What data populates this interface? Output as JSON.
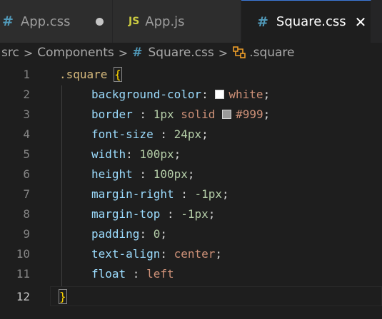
{
  "tabs": [
    {
      "icon": "#",
      "label": "App.css",
      "dirty": true
    },
    {
      "icon": "JS",
      "label": "App.js"
    },
    {
      "icon": "#",
      "label": "Square.css",
      "close": "✕"
    }
  ],
  "breadcrumb": {
    "parts": [
      "src",
      "Components",
      "Square.css",
      ".square"
    ],
    "separator": ">"
  },
  "colors": {
    "swatch_white": "#ffffff",
    "swatch_999": "#999999"
  },
  "editor": {
    "line_numbers": [
      "1",
      "2",
      "3",
      "4",
      "5",
      "6",
      "7",
      "8",
      "9",
      "10",
      "11",
      "12"
    ],
    "lines": [
      {
        "selector": ".square",
        "brace": "{"
      },
      {
        "prop": "background-color",
        "sep": ": ",
        "value": "white",
        "end": ";"
      },
      {
        "prop": "border",
        "sep": " : ",
        "num": "1px",
        "value": "solid",
        "value2": "#999",
        "end": ";"
      },
      {
        "prop": "font-size",
        "sep": " : ",
        "num": "24px",
        "end": ";"
      },
      {
        "prop": "width",
        "sep": ": ",
        "num": "100px",
        "end": ";"
      },
      {
        "prop": "height",
        "sep": " : ",
        "num": "100px",
        "end": ";"
      },
      {
        "prop": "margin-right",
        "sep": " : ",
        "num": "-1px",
        "end": ";"
      },
      {
        "prop": "margin-top",
        "sep": " : ",
        "num": "-1px",
        "end": ";"
      },
      {
        "prop": "padding",
        "sep": ": ",
        "num": "0",
        "end": ";"
      },
      {
        "prop": "text-align",
        "sep": ": ",
        "value": "center",
        "end": ";"
      },
      {
        "prop": "float",
        "sep": " : ",
        "value": "left",
        "end": ""
      },
      {
        "brace": "}"
      }
    ]
  }
}
